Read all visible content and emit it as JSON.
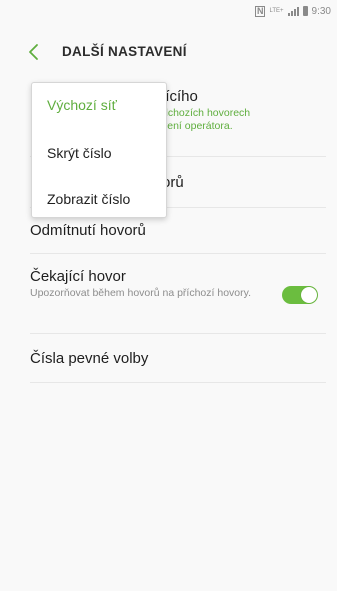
{
  "status_bar": {
    "nfc": "N",
    "lte": "LTE+",
    "time": "9:30"
  },
  "header": {
    "back_icon": "chevron-left-icon",
    "title": "DALŠÍ NASTAVENÍ"
  },
  "settings": {
    "caller_id": {
      "label_partial": "jícího",
      "sub_line1": "dchozích hovorech",
      "sub_line2": "vení operátora."
    },
    "call_forwarding": {
      "label_partial": "orů"
    },
    "call_barring": {
      "label": "Odmítnutí hovorů"
    },
    "call_waiting": {
      "label": "Čekající hovor",
      "sub": "Upozorňovat během hovorů na příchozí hovory.",
      "enabled": true
    },
    "fixed_dialing": {
      "label": "Čísla pevné volby"
    }
  },
  "popup": {
    "options": [
      {
        "label": "Výchozí síť",
        "selected": true
      },
      {
        "label": "Skrýt číslo",
        "selected": false
      },
      {
        "label": "Zobrazit číslo",
        "selected": false
      }
    ]
  },
  "colors": {
    "accent": "#5fae3e",
    "toggle_on": "#6bbd3f",
    "background": "#f9f9f9"
  }
}
